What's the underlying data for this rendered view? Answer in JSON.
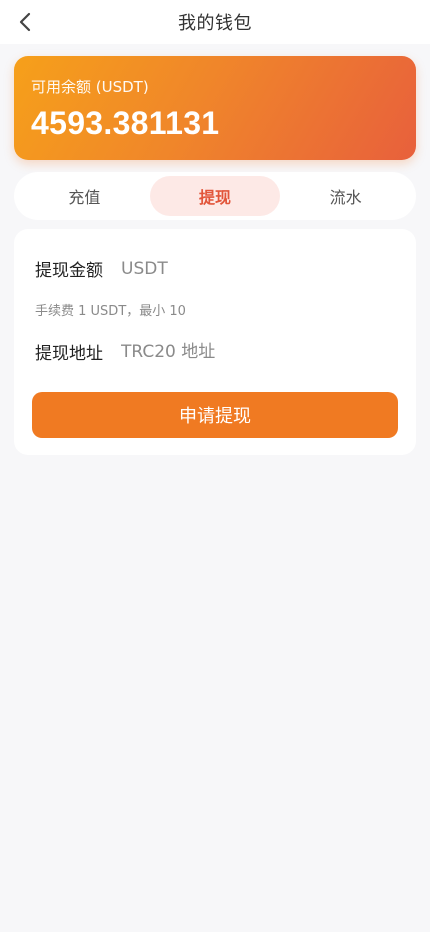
{
  "header": {
    "title": "我的钱包"
  },
  "balance": {
    "label": "可用余额 (USDT)",
    "value": "4593.381131"
  },
  "tabs": [
    {
      "label": "充值",
      "active": false
    },
    {
      "label": "提现",
      "active": true
    },
    {
      "label": "流水",
      "active": false
    }
  ],
  "withdraw_form": {
    "amount_label": "提现金额",
    "amount_placeholder": "USDT",
    "amount_value": "",
    "fee_note": "手续费 1 USDT，最小 10",
    "address_label": "提现地址",
    "address_placeholder": "TRC20 地址",
    "address_value": "",
    "submit_label": "申请提现"
  },
  "colors": {
    "accent": "#f07a22",
    "card_gradient_start": "#f6a01a",
    "card_gradient_end": "#e8603c",
    "active_tab_bg": "#fde9e6",
    "active_tab_text": "#e2553a",
    "page_bg": "#f7f7f9"
  },
  "icons": {
    "back": "chevron-left-icon"
  }
}
